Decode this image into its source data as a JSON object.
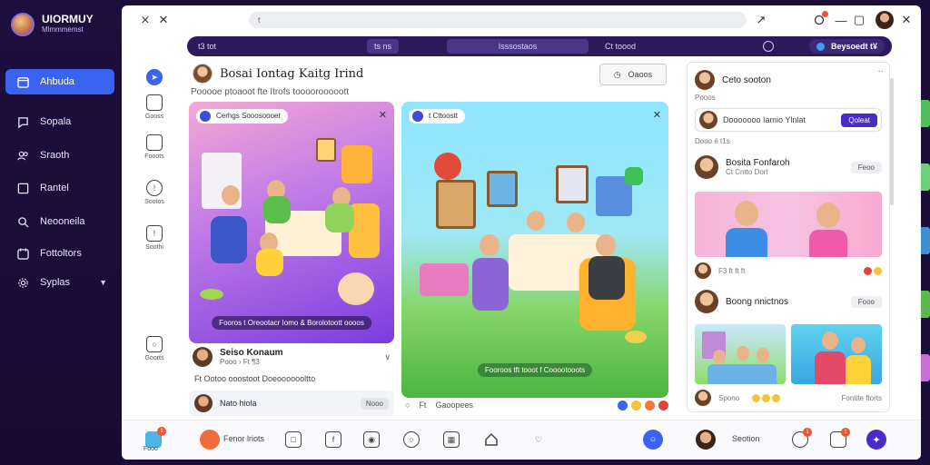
{
  "brand": {
    "title": "UIORMUY",
    "subtitle": "Mlmmmemst"
  },
  "sidebar": {
    "items": [
      {
        "label": "Ahbuda",
        "icon": "calendar-icon",
        "active": true
      },
      {
        "label": "Sopala",
        "icon": "chat-icon"
      },
      {
        "label": "Sraoth",
        "icon": "users-icon"
      },
      {
        "label": "Rantel",
        "icon": "square-icon"
      },
      {
        "label": "Neooneila",
        "icon": "search-icon"
      },
      {
        "label": "Fottoltors",
        "icon": "calendar-icon"
      },
      {
        "label": "Syplas",
        "icon": "gear-icon"
      }
    ]
  },
  "window": {
    "address": "t",
    "topbar": {
      "left": "t3 tot",
      "mid1": "ts ns",
      "mid2": "Isssostaos",
      "right_mid": "Ct toood",
      "pill": "Beysoedt t¥"
    }
  },
  "rail": [
    {
      "label": ""
    },
    {
      "label": "Gooss"
    },
    {
      "label": "Fooots"
    },
    {
      "label": "Sootos"
    },
    {
      "label": "Soothi"
    },
    {
      "label": "Goorts"
    }
  ],
  "post": {
    "title": "Bosai Iontag Kaitg Irind",
    "subtitle": "Pooooe ptoaoot fte Itrofs toooorooooott",
    "share_label": "Oaoos"
  },
  "card1": {
    "chip": "Cerhgs Sooosoooet",
    "caption": "Fooros t Oreootacr Iomo & Borolotoott oooos"
  },
  "card2": {
    "chip": "t Cttoostt",
    "caption": "Fooroos tft tooot f Cooootooots"
  },
  "below1": {
    "name": "Seiso Konaum",
    "meta": "Pooo › Ft ¶3",
    "text": "Ft Ootoo ooostoot Doeooooooltto",
    "comment_name": "Nato hiola",
    "comment_pill": "Nooo"
  },
  "card2_foot": {
    "count": "Ft",
    "label": "Gaoopees"
  },
  "rpanel": {
    "header": "Ceto sooton",
    "header_sub": "Pooos",
    "input_name": "Dooooooo Iamio Ylnlat",
    "input_btn": "Qoleat",
    "meta": "Dooo é t1s",
    "post1_name": "Bosita Fonfaroh",
    "post1_sub": "Ct Cntto Dort",
    "post1_pill": "Feoo",
    "post1_foot": "F3 ft ft ft",
    "post2_name": "Boong nnictnos",
    "post2_sub": "",
    "post2_pill": "Fooo",
    "post2_foot_left": "Spono",
    "post2_foot_right": "Fontite ftorts"
  },
  "bottombar": {
    "first_label": "Fooo",
    "friend_label": "Fenor lriots",
    "user_label": "Seotion"
  },
  "colors": {
    "accent": "#3b63f3",
    "sidebar_bg": "#1d0f3d",
    "topbar_bg": "#2d1a5b",
    "button_purple": "#4a2bc8",
    "badge": "#f0532f"
  }
}
